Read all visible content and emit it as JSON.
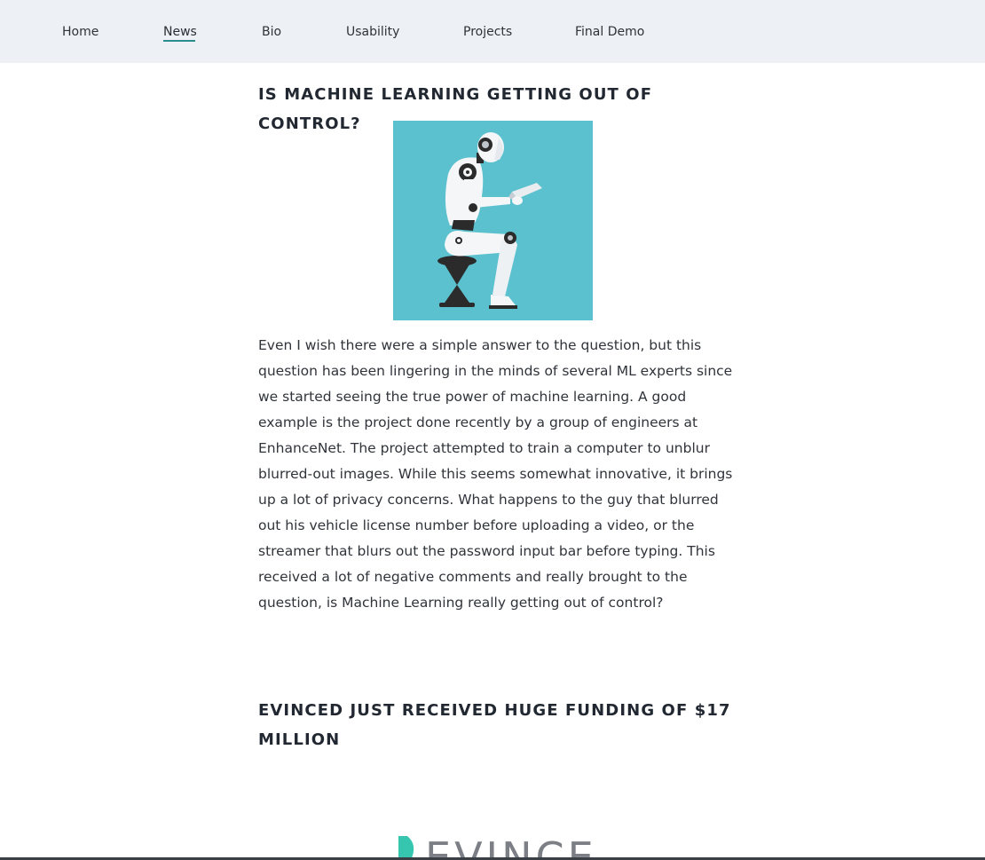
{
  "nav": {
    "items": [
      {
        "label": "Home"
      },
      {
        "label": "News"
      },
      {
        "label": "Bio"
      },
      {
        "label": "Usability"
      },
      {
        "label": "Projects"
      },
      {
        "label": "Final Demo"
      }
    ],
    "active": "News"
  },
  "articles": [
    {
      "title": "IS MACHINE LEARNING GETTING OUT OF CONTROL?",
      "image": "robot-reading-book-illustration",
      "body": "Even I wish there were a simple answer to the question, but this question has been lingering in the minds of several ML experts since we started seeing the true power of machine learning. A good example is the project done recently by a group of engineers at EnhanceNet. The project attempted to train a computer to unblur blurred-out images. While this seems somewhat innovative, it brings up a lot of privacy concerns. What happens to the guy that blurred out his vehicle license number before uploading a video, or the streamer that blurs out the password input bar before typing. This received a lot of negative comments and really brought to the question, is Machine Learning really getting out of control?"
    },
    {
      "title": "EVINCED JUST RECEIVED HUGE FUNDING OF $17 MILLION",
      "image": "evinced-logo",
      "logo_text": "EVINCED"
    }
  ],
  "colors": {
    "nav_bg": "#edf1f5",
    "accent": "#2a8c8c",
    "image_bg": "#5bc1cf"
  }
}
